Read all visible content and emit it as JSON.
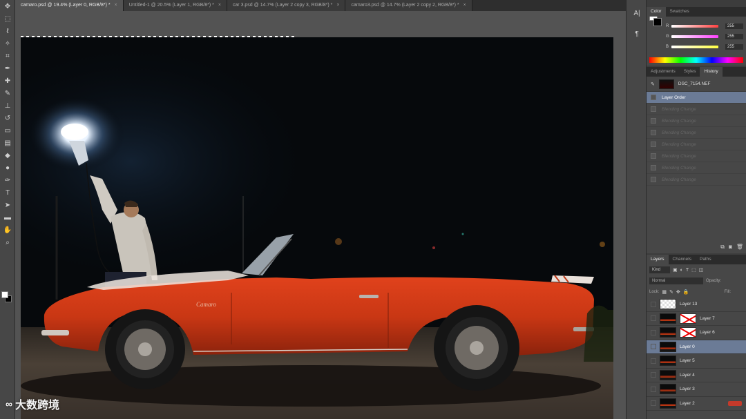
{
  "tabs": [
    {
      "label": "camaro.psd @ 19.4% (Layer 0, RGB/8*) *",
      "active": true
    },
    {
      "label": "Untitled-1 @ 20.5% (Layer 1, RGB/8*) *",
      "active": false
    },
    {
      "label": "car 3.psd @ 14.7% (Layer 2 copy 3, RGB/8*) *",
      "active": false
    },
    {
      "label": "camaro3.psd @ 14.7% (Layer 2 copy 2, RGB/8*) *",
      "active": false
    }
  ],
  "tab_close_glyph": "×",
  "tools": [
    "move-icon",
    "marquee-icon",
    "lasso-icon",
    "magic-wand-icon",
    "crop-icon",
    "eyedropper-icon",
    "healing-brush-icon",
    "brush-icon",
    "clone-stamp-icon",
    "history-brush-icon",
    "eraser-icon",
    "gradient-icon",
    "blur-icon",
    "dodge-icon",
    "pen-icon",
    "type-icon",
    "path-selection-icon",
    "shape-icon",
    "hand-icon",
    "zoom-icon"
  ],
  "color_panel": {
    "tabs": [
      "Color",
      "Swatches"
    ],
    "active_tab": "Color",
    "channels": [
      {
        "label": "R",
        "value": "255",
        "color": "#ff4040"
      },
      {
        "label": "G",
        "value": "255",
        "color": "#ff40ff"
      },
      {
        "label": "B",
        "value": "255",
        "color": "#ffff40"
      }
    ]
  },
  "history_panel": {
    "tabs": [
      "Adjustments",
      "Styles",
      "History"
    ],
    "active_tab": "History",
    "source": "DSC_7154.NEF",
    "states": [
      {
        "label": "Layer Order",
        "active": true
      },
      {
        "label": "Blending Change",
        "active": false
      },
      {
        "label": "Blending Change",
        "active": false
      },
      {
        "label": "Blending Change",
        "active": false
      },
      {
        "label": "Blending Change",
        "active": false
      },
      {
        "label": "Blending Change",
        "active": false
      },
      {
        "label": "Blending Change",
        "active": false
      },
      {
        "label": "Blending Change",
        "active": false
      }
    ]
  },
  "layers_panel": {
    "tabs": [
      "Layers",
      "Channels",
      "Paths"
    ],
    "active_tab": "Layers",
    "kind_label": "Kind",
    "blend_mode": "Normal",
    "opacity_label": "Opacity:",
    "lock_label": "Lock:",
    "fill_label": "Fill:",
    "layers": [
      {
        "name": "Layer 13",
        "thumb": "check",
        "mask": false,
        "active": false
      },
      {
        "name": "Layer 7",
        "thumb": "photo",
        "mask": true,
        "active": false
      },
      {
        "name": "Layer 6",
        "thumb": "photo",
        "mask": true,
        "active": false
      },
      {
        "name": "Layer 0",
        "thumb": "photo",
        "mask": false,
        "active": true
      },
      {
        "name": "Layer 5",
        "thumb": "photo",
        "mask": false,
        "active": false
      },
      {
        "name": "Layer 4",
        "thumb": "photo",
        "mask": false,
        "active": false
      },
      {
        "name": "Layer 3",
        "thumb": "photo",
        "mask": false,
        "active": false
      },
      {
        "name": "Layer 2",
        "thumb": "photo",
        "mask": false,
        "active": false
      }
    ]
  },
  "photo": {
    "car_badge": "Camaro"
  },
  "watermark": {
    "text": "大数跨境"
  }
}
